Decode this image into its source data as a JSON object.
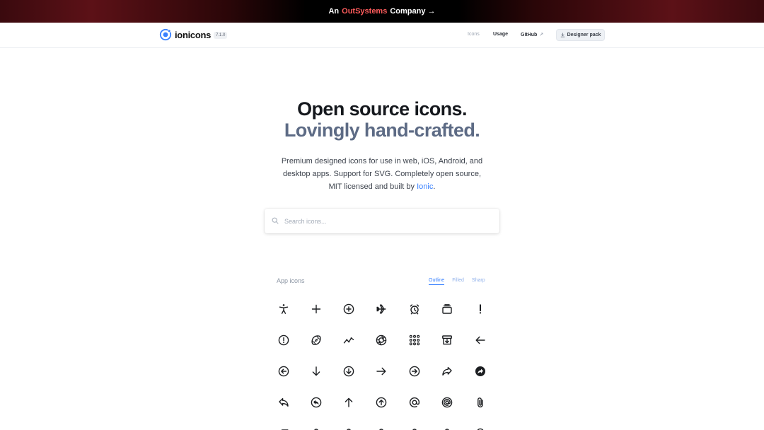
{
  "banner": {
    "prefix": "An",
    "brand": "OutSystems",
    "suffix": "Company →"
  },
  "header": {
    "logo_text": "ionicons",
    "version": "7.1.0",
    "nav": {
      "icons": "Icons",
      "usage": "Usage",
      "github": "GitHub",
      "designer_pack": "Designer pack"
    }
  },
  "hero": {
    "title": "Open source icons.",
    "subtitle": "Lovingly hand-crafted.",
    "desc_1": "Premium designed icons for use in web, iOS, Android, and desktop apps. Support for SVG. Completely open source, MIT licensed and built by",
    "desc_link": "Ionic",
    "desc_end": "."
  },
  "search": {
    "placeholder": "Search icons..."
  },
  "section": {
    "title": "App icons",
    "tabs": [
      "Outline",
      "Filled",
      "Sharp"
    ],
    "active_tab": "Outline"
  },
  "icons": [
    [
      "accessibility-icon",
      "add-icon",
      "add-circle-icon",
      "airplane-icon",
      "alarm-icon",
      "albums-icon",
      "alert-icon"
    ],
    [
      "alert-circle-icon",
      "american-football-icon",
      "analytics-icon",
      "aperture-icon",
      "apps-icon",
      "archive-icon",
      "arrow-back-icon"
    ],
    [
      "arrow-back-circle-icon",
      "arrow-down-icon",
      "arrow-down-circle-icon",
      "arrow-forward-icon",
      "arrow-forward-circle-icon",
      "arrow-redo-icon",
      "arrow-redo-circle-icon"
    ],
    [
      "arrow-undo-icon",
      "arrow-undo-circle-icon",
      "arrow-up-icon",
      "arrow-up-circle-icon",
      "at-icon",
      "at-circle-icon",
      "attach-icon"
    ],
    [
      "backspace-icon",
      "bag-icon",
      "bag-add-icon",
      "bag-check-icon",
      "bag-handle-icon",
      "bag-remove-icon",
      "balloon-icon"
    ]
  ],
  "colors": {
    "accent": "#3880ff",
    "brand_red": "#ff5c5c",
    "subtitle": "#5d6b85"
  }
}
